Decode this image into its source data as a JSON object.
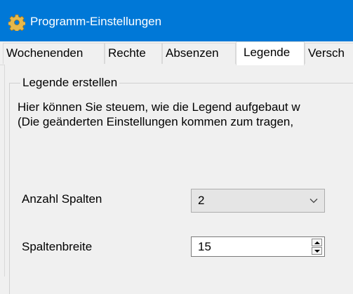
{
  "window": {
    "title": "Programm-Einstellungen",
    "icon": "gear-icon",
    "accent_color": "#0078d7"
  },
  "tabs": [
    {
      "label": "Wochenenden",
      "active": false
    },
    {
      "label": "Rechte",
      "active": false
    },
    {
      "label": "Absenzen",
      "active": false
    },
    {
      "label": "Legende",
      "active": true
    },
    {
      "label": "Versch",
      "active": false
    }
  ],
  "group": {
    "title": "Legende erstellen",
    "description_line1": "Hier können Sie steuem, wie die Legend aufgebaut w",
    "description_line2": "(Die geänderten Einstellungen kommen zum tragen,"
  },
  "fields": {
    "columns_label": "Anzahl Spalten",
    "columns_value": "2",
    "width_label": "Spaltenbreite",
    "width_value": "15"
  }
}
